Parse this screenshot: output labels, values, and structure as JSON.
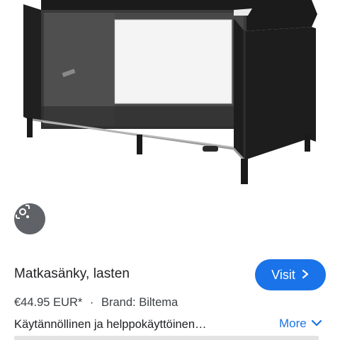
{
  "product": {
    "title": "Matkasänky, lasten",
    "price": "€44.95 EUR*",
    "separator": "·",
    "brand": "Brand: Biltema",
    "description": "Käytännöllinen ja helppokäyttöinen…"
  },
  "actions": {
    "visit_label": "Visit",
    "more_label": "More"
  },
  "icons": {
    "lens": "lens-icon",
    "chevron_right": "chevron-right-icon",
    "chevron_down": "chevron-down-icon"
  },
  "colors": {
    "accent": "#1a73e8",
    "lens_button": "#5f6368",
    "crib_fabric": "#1f1f1f"
  }
}
